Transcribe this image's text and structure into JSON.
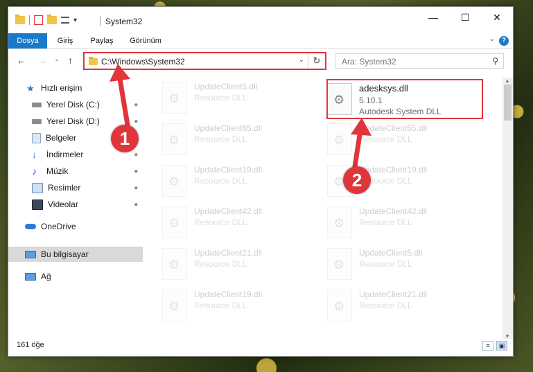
{
  "window": {
    "title": "System32",
    "minimize_glyph": "—",
    "maximize_glyph": "☐",
    "close_glyph": "✕"
  },
  "ribbon": {
    "tabs": [
      "Dosya",
      "Giriş",
      "Paylaş",
      "Görünüm"
    ],
    "help_glyph": "?",
    "collapse_glyph": "⌄"
  },
  "toolbar": {
    "back_glyph": "←",
    "forward_glyph": "→",
    "recent_glyph": "⌄",
    "up_glyph": "↑"
  },
  "address": {
    "path": "C:\\Windows\\System32",
    "dropdown_glyph": "⌄",
    "refresh_glyph": "↻"
  },
  "search": {
    "placeholder": "Ara: System32",
    "icon_glyph": "⚲"
  },
  "sidebar": {
    "items": [
      {
        "label": "Hızlı erişim",
        "icon": "star-icon",
        "pinned": false
      },
      {
        "label": "Yerel Disk (C:)",
        "icon": "drive-icon",
        "pinned": true
      },
      {
        "label": "Yerel Disk (D:)",
        "icon": "drive-icon",
        "pinned": true
      },
      {
        "label": "Belgeler",
        "icon": "documents-icon",
        "pinned": true
      },
      {
        "label": "İndirmeler",
        "icon": "download-icon",
        "pinned": true
      },
      {
        "label": "Müzik",
        "icon": "music-icon",
        "pinned": true
      },
      {
        "label": "Resimler",
        "icon": "pictures-icon",
        "pinned": true
      },
      {
        "label": "Videolar",
        "icon": "videos-icon",
        "pinned": true
      },
      {
        "label": "OneDrive",
        "icon": "cloud-icon",
        "pinned": false
      },
      {
        "label": "Bu bilgisayar",
        "icon": "computer-icon",
        "pinned": false,
        "selected": true
      },
      {
        "label": "Ağ",
        "icon": "network-icon",
        "pinned": false
      }
    ],
    "pin_glyph": "📌"
  },
  "files": {
    "left_column": [
      {
        "name": "UpdateClient5.dll",
        "type": "Resource DLL"
      },
      {
        "name": "UpdateClient65.dll",
        "type": "Resource DLL"
      },
      {
        "name": "UpdateClient19.dll",
        "type": "Resource DLL"
      },
      {
        "name": "UpdateClient42.dll",
        "type": "Resource DLL"
      },
      {
        "name": "UpdateClient21.dll",
        "type": "Resource DLL"
      },
      {
        "name": "UpdateClient19.dll",
        "type": "Resource DLL"
      }
    ],
    "right_column": [
      {
        "name": "adesksys.dll",
        "version": "5.10.1",
        "type": "Autodesk System DLL"
      },
      {
        "name": "UpdateClient65.dll",
        "type": "Resource DLL"
      },
      {
        "name": "UpdateClient19.dll",
        "type": "Resource DLL"
      },
      {
        "name": "UpdateClient42.dll",
        "type": "Resource DLL"
      },
      {
        "name": "UpdateClient5.dll",
        "type": "Resource DLL"
      },
      {
        "name": "UpdateClient21.dll",
        "type": "Resource DLL"
      }
    ]
  },
  "status": {
    "item_count": "161 öğe"
  },
  "callouts": {
    "first": "1",
    "second": "2"
  },
  "colors": {
    "accent": "#1979ca",
    "highlight": "#e0353b"
  }
}
